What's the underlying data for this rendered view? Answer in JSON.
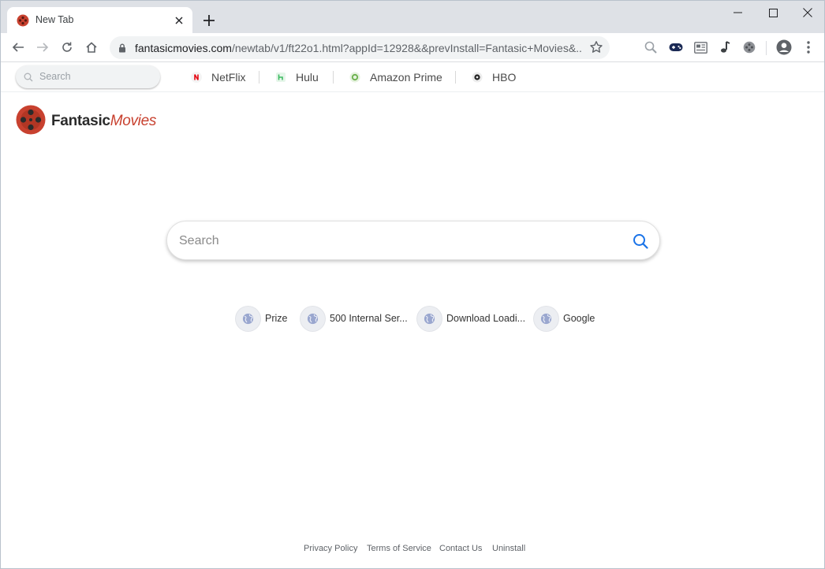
{
  "browser": {
    "tab_title": "New Tab",
    "url_host": "fantasicmovies.com",
    "url_rest": "/newtab/v1/ft22o1.html?appId=12928&&prevInstall=Fantasic+Movies&..."
  },
  "quickbar": {
    "search_placeholder": "Search",
    "links": [
      {
        "label": "NetFlix",
        "icon": "netflix-icon",
        "color": "#e50914"
      },
      {
        "label": "Hulu",
        "icon": "hulu-icon",
        "color": "#3dbb61"
      },
      {
        "label": "Amazon Prime",
        "icon": "amazon-prime-icon",
        "color": "#6ab04c"
      },
      {
        "label": "HBO",
        "icon": "hbo-icon",
        "color": "#222222"
      }
    ]
  },
  "logo": {
    "part1": "Fantasic",
    "part2": "Movies",
    "accent": "#c8412f"
  },
  "main": {
    "search_placeholder": "Search",
    "shortcuts": [
      {
        "label": "Prize"
      },
      {
        "label": "500 Internal Ser..."
      },
      {
        "label": "Download Loadi..."
      },
      {
        "label": "Google"
      }
    ]
  },
  "footer": {
    "links": [
      "Privacy Policy",
      "Terms of Service",
      "Contact Us",
      "Uninstall"
    ]
  },
  "colors": {
    "link_blue": "#1a73e8",
    "chrome_bg": "#dee1e6"
  }
}
